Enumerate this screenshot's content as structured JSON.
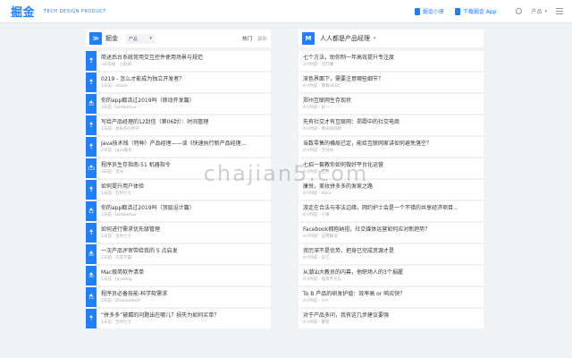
{
  "topbar": {
    "logo": "掘金",
    "tagline": "TECH DESIGN PRODUCT",
    "links": [
      "掘金小册",
      "下载掘金 App"
    ],
    "settings_label": "产品",
    "settings_caret": "▾",
    "link_icons": [
      "book-icon",
      "phone-icon"
    ]
  },
  "left": {
    "header": {
      "icon": "≫",
      "name": "掘金",
      "select": "产品",
      "select_caret": "▾",
      "sort_hot": "热门",
      "sort_new": "最新"
    },
    "items": [
      {
        "votes": "2",
        "title": "简述后台系统常用交互控件使用场景与规范",
        "meta": "3天前发 · 小赵哥"
      },
      {
        "votes": "2",
        "title": "0219 - 怎么才能成为独立开发者？",
        "meta": "1天前 · atlase"
      },
      {
        "votes": "10",
        "title": "你的app都活过2019吗（移动开发篇）",
        "meta": "3天前 · lambertux"
      },
      {
        "votes": "2",
        "title": "写给产品经理的12封信（第06封）：时间管理",
        "meta": "1天前 · 星乐的小胖子"
      },
      {
        "votes": "5",
        "title": "Java技术栈（特种）产品经理——谈《快速执行新产品经理...",
        "meta": "2天前 · Java服务"
      },
      {
        "votes": "113",
        "title": "程序员生存指南-51 机器指令",
        "meta": "3天前 · 流光"
      },
      {
        "votes": "4",
        "title": "如何提升用户体验",
        "meta": "1天前 · 吉时七七"
      },
      {
        "votes": "12",
        "title": "你的app都活过2019吗（顶层设计篇）",
        "meta": "1天前 · lambertux"
      },
      {
        "votes": "3",
        "title": "如何进行需求优先级管理",
        "meta": "1天前 · 吉时七七"
      },
      {
        "votes": "46",
        "title": "一次产品评审带给我的 5 点启发",
        "meta": "2天前 · 巧克学霸"
      },
      {
        "votes": "36",
        "title": "Mac极简软件清单",
        "meta": "1天前 · JavaDog"
      },
      {
        "votes": "15",
        "title": "程序员必备技能-科学软需求",
        "meta": "1天前 · ZhanasHoch"
      },
      {
        "votes": "7",
        "title": "“拼多多”被薅的问题出在哪儿？损失为如何买单？",
        "meta": "1天前 · 吉时七七"
      }
    ]
  },
  "right": {
    "header": {
      "icon": "M",
      "name": "人人都是产品经理",
      "caret": "▾"
    },
    "items": [
      {
        "title": "七个方法，助你制一年高效提升专注度",
        "meta": "3小时前 · 刘万峰"
      },
      {
        "title": "深色界面下，需要注意哪些细节？",
        "meta": "4小时前 · 网易UEDC"
      },
      {
        "title": "郑州互联网生存现状",
        "meta": "4小时前 · 赵一"
      },
      {
        "title": "先有社交才有互联网：郑霞中的社交电商",
        "meta": "4小时前 · 佛光的阿斯"
      },
      {
        "title": "当数零售的横局已定，能给互联网家讲如何避免落空？",
        "meta": "4小时前 · 艺分树"
      },
      {
        "title": "七招一套教你如何做好平台化运营",
        "meta": "4小时前 · 王亮"
      },
      {
        "title": "康悦，美妆拼多多的发家之路",
        "meta": "4小时前 · Alice"
      },
      {
        "title": "游走在合法与非法边缘，网约护士会是一个不错的共享经济项目...",
        "meta": "4小时前 · 小栗"
      },
      {
        "title": "Facebook拥抱纳祖，社交媒体运营如何应对新趋势？",
        "meta": "4小时前 · 应用解读"
      },
      {
        "title": "资历深不是优势，把身已完成资源才是",
        "meta": "4小时前 · 史亿"
      },
      {
        "title": "从潮汕大教员的内幕，他职场人的3个捐握",
        "meta": "4小时前 · 张风不大头"
      },
      {
        "title": "To B 产品的研发护值：效率高 or 响应快？",
        "meta": "4小时前 · 小A"
      },
      {
        "title": "对于产品多问，我有这几步建议要强",
        "meta": "4小时前 · 聚智"
      }
    ]
  },
  "watermark": "chajian5.com",
  "colors": {
    "accent": "#1e80ff",
    "background": "#f0f2f4"
  }
}
